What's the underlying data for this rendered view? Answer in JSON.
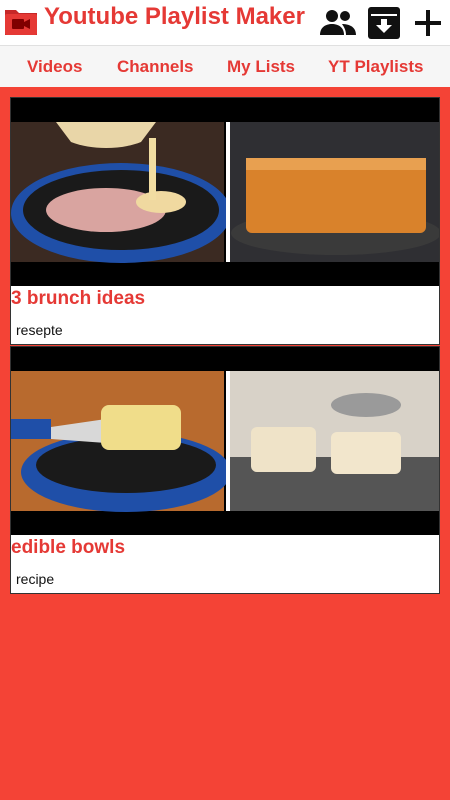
{
  "app": {
    "title": "Youtube Playlist Maker",
    "accent_color": "#e53935",
    "background_color": "#f44336"
  },
  "toolbar": {
    "icons": [
      "people-icon",
      "archive-download-icon",
      "add-icon"
    ]
  },
  "tabs": [
    {
      "label": "Videos"
    },
    {
      "label": "Channels"
    },
    {
      "label": "My Lists"
    },
    {
      "label": "YT Playlists"
    }
  ],
  "playlists": [
    {
      "title": "3 brunch ideas",
      "description": "resepte"
    },
    {
      "title": "edible bowls",
      "description": "recipe"
    }
  ]
}
